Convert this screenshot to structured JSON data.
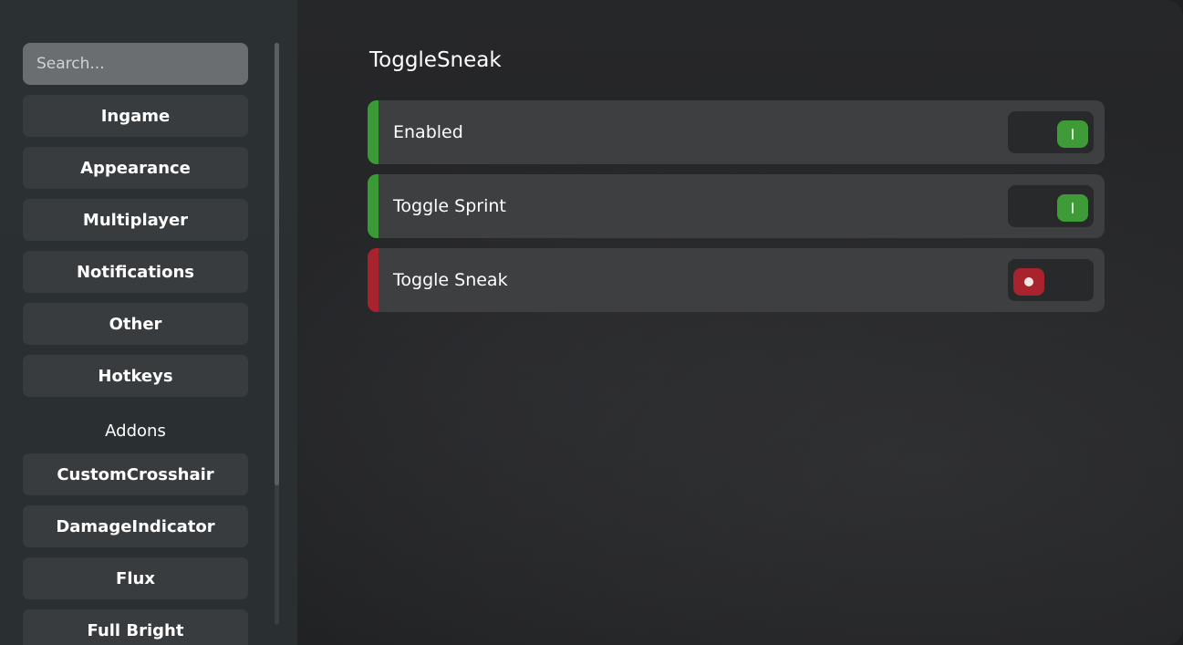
{
  "sidebar": {
    "search_placeholder": "Search...",
    "items": [
      {
        "label": "Ingame"
      },
      {
        "label": "Appearance"
      },
      {
        "label": "Multiplayer"
      },
      {
        "label": "Notifications"
      },
      {
        "label": "Other"
      },
      {
        "label": "Hotkeys"
      }
    ],
    "section_label": "Addons",
    "addons": [
      {
        "label": "CustomCrosshair"
      },
      {
        "label": "DamageIndicator"
      },
      {
        "label": "Flux"
      },
      {
        "label": "Full Bright"
      }
    ]
  },
  "main": {
    "title": "ToggleSneak",
    "settings": [
      {
        "label": "Enabled",
        "state": "on",
        "accent": "#3a9a35"
      },
      {
        "label": "Toggle Sprint",
        "state": "on",
        "accent": "#3a9a35"
      },
      {
        "label": "Toggle Sneak",
        "state": "off",
        "accent": "#a8232e"
      }
    ]
  },
  "colors": {
    "on": "#3e9b37",
    "off": "#a8232e"
  },
  "icons": {
    "toggle_on": "toggle-on-icon",
    "toggle_off": "toggle-off-icon"
  }
}
